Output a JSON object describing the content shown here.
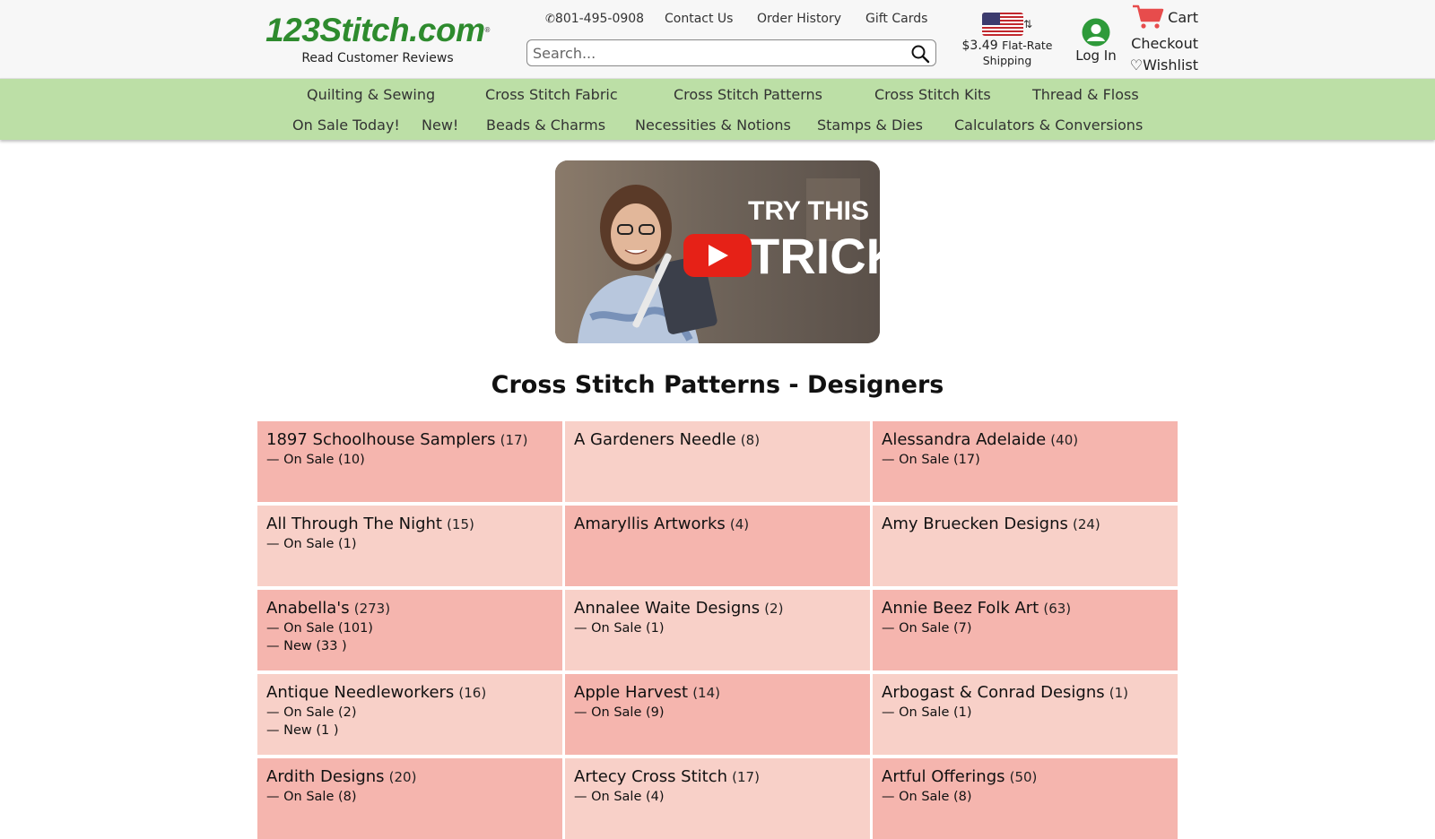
{
  "header": {
    "logo_text": "123Stitch.com",
    "logo_reg": "®",
    "reviews_label": "Read Customer Reviews",
    "phone": "801-495-0908",
    "contact_label": "Contact Us",
    "order_history_label": "Order History",
    "gift_cards_label": "Gift Cards",
    "search_placeholder": "Search...",
    "shipping_price": "$3.49",
    "shipping_label_1": "Flat-Rate",
    "shipping_label_2": "Shipping",
    "login_label": "Log In",
    "cart_label": "Cart",
    "checkout_label": "Checkout",
    "wishlist_label": "Wishlist"
  },
  "nav": {
    "row1": [
      "Quilting & Sewing",
      "Cross Stitch Fabric",
      "Cross Stitch Patterns",
      "Cross Stitch Kits",
      "Thread & Floss"
    ],
    "row2": [
      "On Sale Today!",
      "New!",
      "Beads & Charms",
      "Necessities & Notions",
      "Stamps & Dies",
      "Calculators & Conversions"
    ]
  },
  "video": {
    "overlay_line1": "TRY THIS",
    "overlay_line2": "TRICK"
  },
  "page_title": "Cross Stitch Patterns - Designers",
  "designers": [
    {
      "name": "1897 Schoolhouse Samplers",
      "count": "(17)",
      "subs": [
        "— On Sale (10)"
      ]
    },
    {
      "name": "A Gardeners Needle",
      "count": "(8)",
      "subs": []
    },
    {
      "name": "Alessandra Adelaide",
      "count": "(40)",
      "subs": [
        "— On Sale (17)"
      ]
    },
    {
      "name": "All Through The Night",
      "count": "(15)",
      "subs": [
        "— On Sale (1)"
      ]
    },
    {
      "name": "Amaryllis Artworks",
      "count": "(4)",
      "subs": []
    },
    {
      "name": "Amy Bruecken Designs",
      "count": "(24)",
      "subs": []
    },
    {
      "name": "Anabella's",
      "count": "(273)",
      "subs": [
        "— On Sale (101)",
        "— New (33 )"
      ]
    },
    {
      "name": "Annalee Waite Designs",
      "count": "(2)",
      "subs": [
        "— On Sale (1)"
      ]
    },
    {
      "name": "Annie Beez Folk Art",
      "count": "(63)",
      "subs": [
        "— On Sale (7)"
      ]
    },
    {
      "name": "Antique Needleworkers",
      "count": "(16)",
      "subs": [
        "— On Sale (2)",
        "— New (1 )"
      ]
    },
    {
      "name": "Apple Harvest",
      "count": "(14)",
      "subs": [
        "— On Sale (9)"
      ]
    },
    {
      "name": "Arbogast & Conrad Designs",
      "count": "(1)",
      "subs": [
        "— On Sale (1)"
      ]
    },
    {
      "name": "Ardith Designs",
      "count": "(20)",
      "subs": [
        "— On Sale (8)"
      ]
    },
    {
      "name": "Artecy Cross Stitch",
      "count": "(17)",
      "subs": [
        "— On Sale (4)"
      ]
    },
    {
      "name": "Artful Offerings",
      "count": "(50)",
      "subs": [
        "— On Sale (8)"
      ]
    }
  ],
  "colors": {
    "logo_green": "#2e8b2e",
    "nav_bg": "#bcdfa6",
    "cell_dark": "#f5b5ae",
    "cell_light": "#f8d0c8",
    "cart_red": "#e74c4c",
    "youtube_red": "#e62117"
  },
  "icons": [
    "phone-icon",
    "search-icon",
    "us-flag-icon",
    "swap-icon",
    "user-icon",
    "cart-icon",
    "heart-icon",
    "play-icon"
  ]
}
